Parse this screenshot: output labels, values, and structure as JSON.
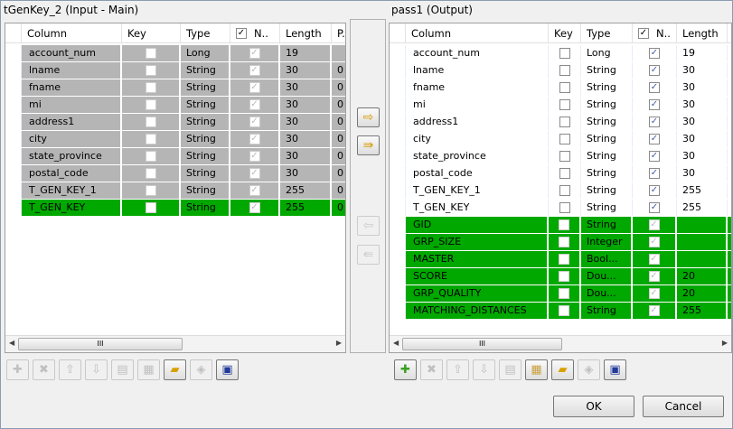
{
  "left": {
    "title": "tGenKey_2 (Input - Main)",
    "headers": [
      "Column",
      "Key",
      "Type",
      "N..",
      "Length",
      "P."
    ],
    "rows": [
      {
        "name": "account_num",
        "type": "Long",
        "length": "19",
        "p": "",
        "style": "gray"
      },
      {
        "name": "lname",
        "type": "String",
        "length": "30",
        "p": "0",
        "style": "gray"
      },
      {
        "name": "fname",
        "type": "String",
        "length": "30",
        "p": "0",
        "style": "gray"
      },
      {
        "name": "mi",
        "type": "String",
        "length": "30",
        "p": "0",
        "style": "gray"
      },
      {
        "name": "address1",
        "type": "String",
        "length": "30",
        "p": "0",
        "style": "gray"
      },
      {
        "name": "city",
        "type": "String",
        "length": "30",
        "p": "0",
        "style": "gray"
      },
      {
        "name": "state_province",
        "type": "String",
        "length": "30",
        "p": "0",
        "style": "gray"
      },
      {
        "name": "postal_code",
        "type": "String",
        "length": "30",
        "p": "0",
        "style": "gray"
      },
      {
        "name": "T_GEN_KEY_1",
        "type": "String",
        "length": "255",
        "p": "0",
        "style": "gray"
      },
      {
        "name": "T_GEN_KEY",
        "type": "String",
        "length": "255",
        "p": "0",
        "style": "green"
      }
    ]
  },
  "right": {
    "title": "pass1 (Output)",
    "headers": [
      "Column",
      "Key",
      "Type",
      "N..",
      "Length",
      ""
    ],
    "rows": [
      {
        "name": "account_num",
        "type": "Long",
        "length": "19",
        "style": "white"
      },
      {
        "name": "lname",
        "type": "String",
        "length": "30",
        "style": "white"
      },
      {
        "name": "fname",
        "type": "String",
        "length": "30",
        "style": "white"
      },
      {
        "name": "mi",
        "type": "String",
        "length": "30",
        "style": "white"
      },
      {
        "name": "address1",
        "type": "String",
        "length": "30",
        "style": "white"
      },
      {
        "name": "city",
        "type": "String",
        "length": "30",
        "style": "white"
      },
      {
        "name": "state_province",
        "type": "String",
        "length": "30",
        "style": "white"
      },
      {
        "name": "postal_code",
        "type": "String",
        "length": "30",
        "style": "white"
      },
      {
        "name": "T_GEN_KEY_1",
        "type": "String",
        "length": "255",
        "style": "white"
      },
      {
        "name": "T_GEN_KEY",
        "type": "String",
        "length": "255",
        "style": "white"
      },
      {
        "name": "GID",
        "type": "String",
        "length": "",
        "style": "green"
      },
      {
        "name": "GRP_SIZE",
        "type": "Integer",
        "length": "",
        "style": "green"
      },
      {
        "name": "MASTER",
        "type": "Bool...",
        "length": "",
        "style": "green"
      },
      {
        "name": "SCORE",
        "type": "Dou...",
        "length": "20",
        "style": "green"
      },
      {
        "name": "GRP_QUALITY",
        "type": "Dou...",
        "length": "20",
        "style": "green"
      },
      {
        "name": "MATCHING_DISTANCES",
        "type": "String",
        "length": "255",
        "style": "green"
      }
    ]
  },
  "scroll_thumb": "III",
  "buttons": {
    "ok": "OK",
    "cancel": "Cancel"
  }
}
